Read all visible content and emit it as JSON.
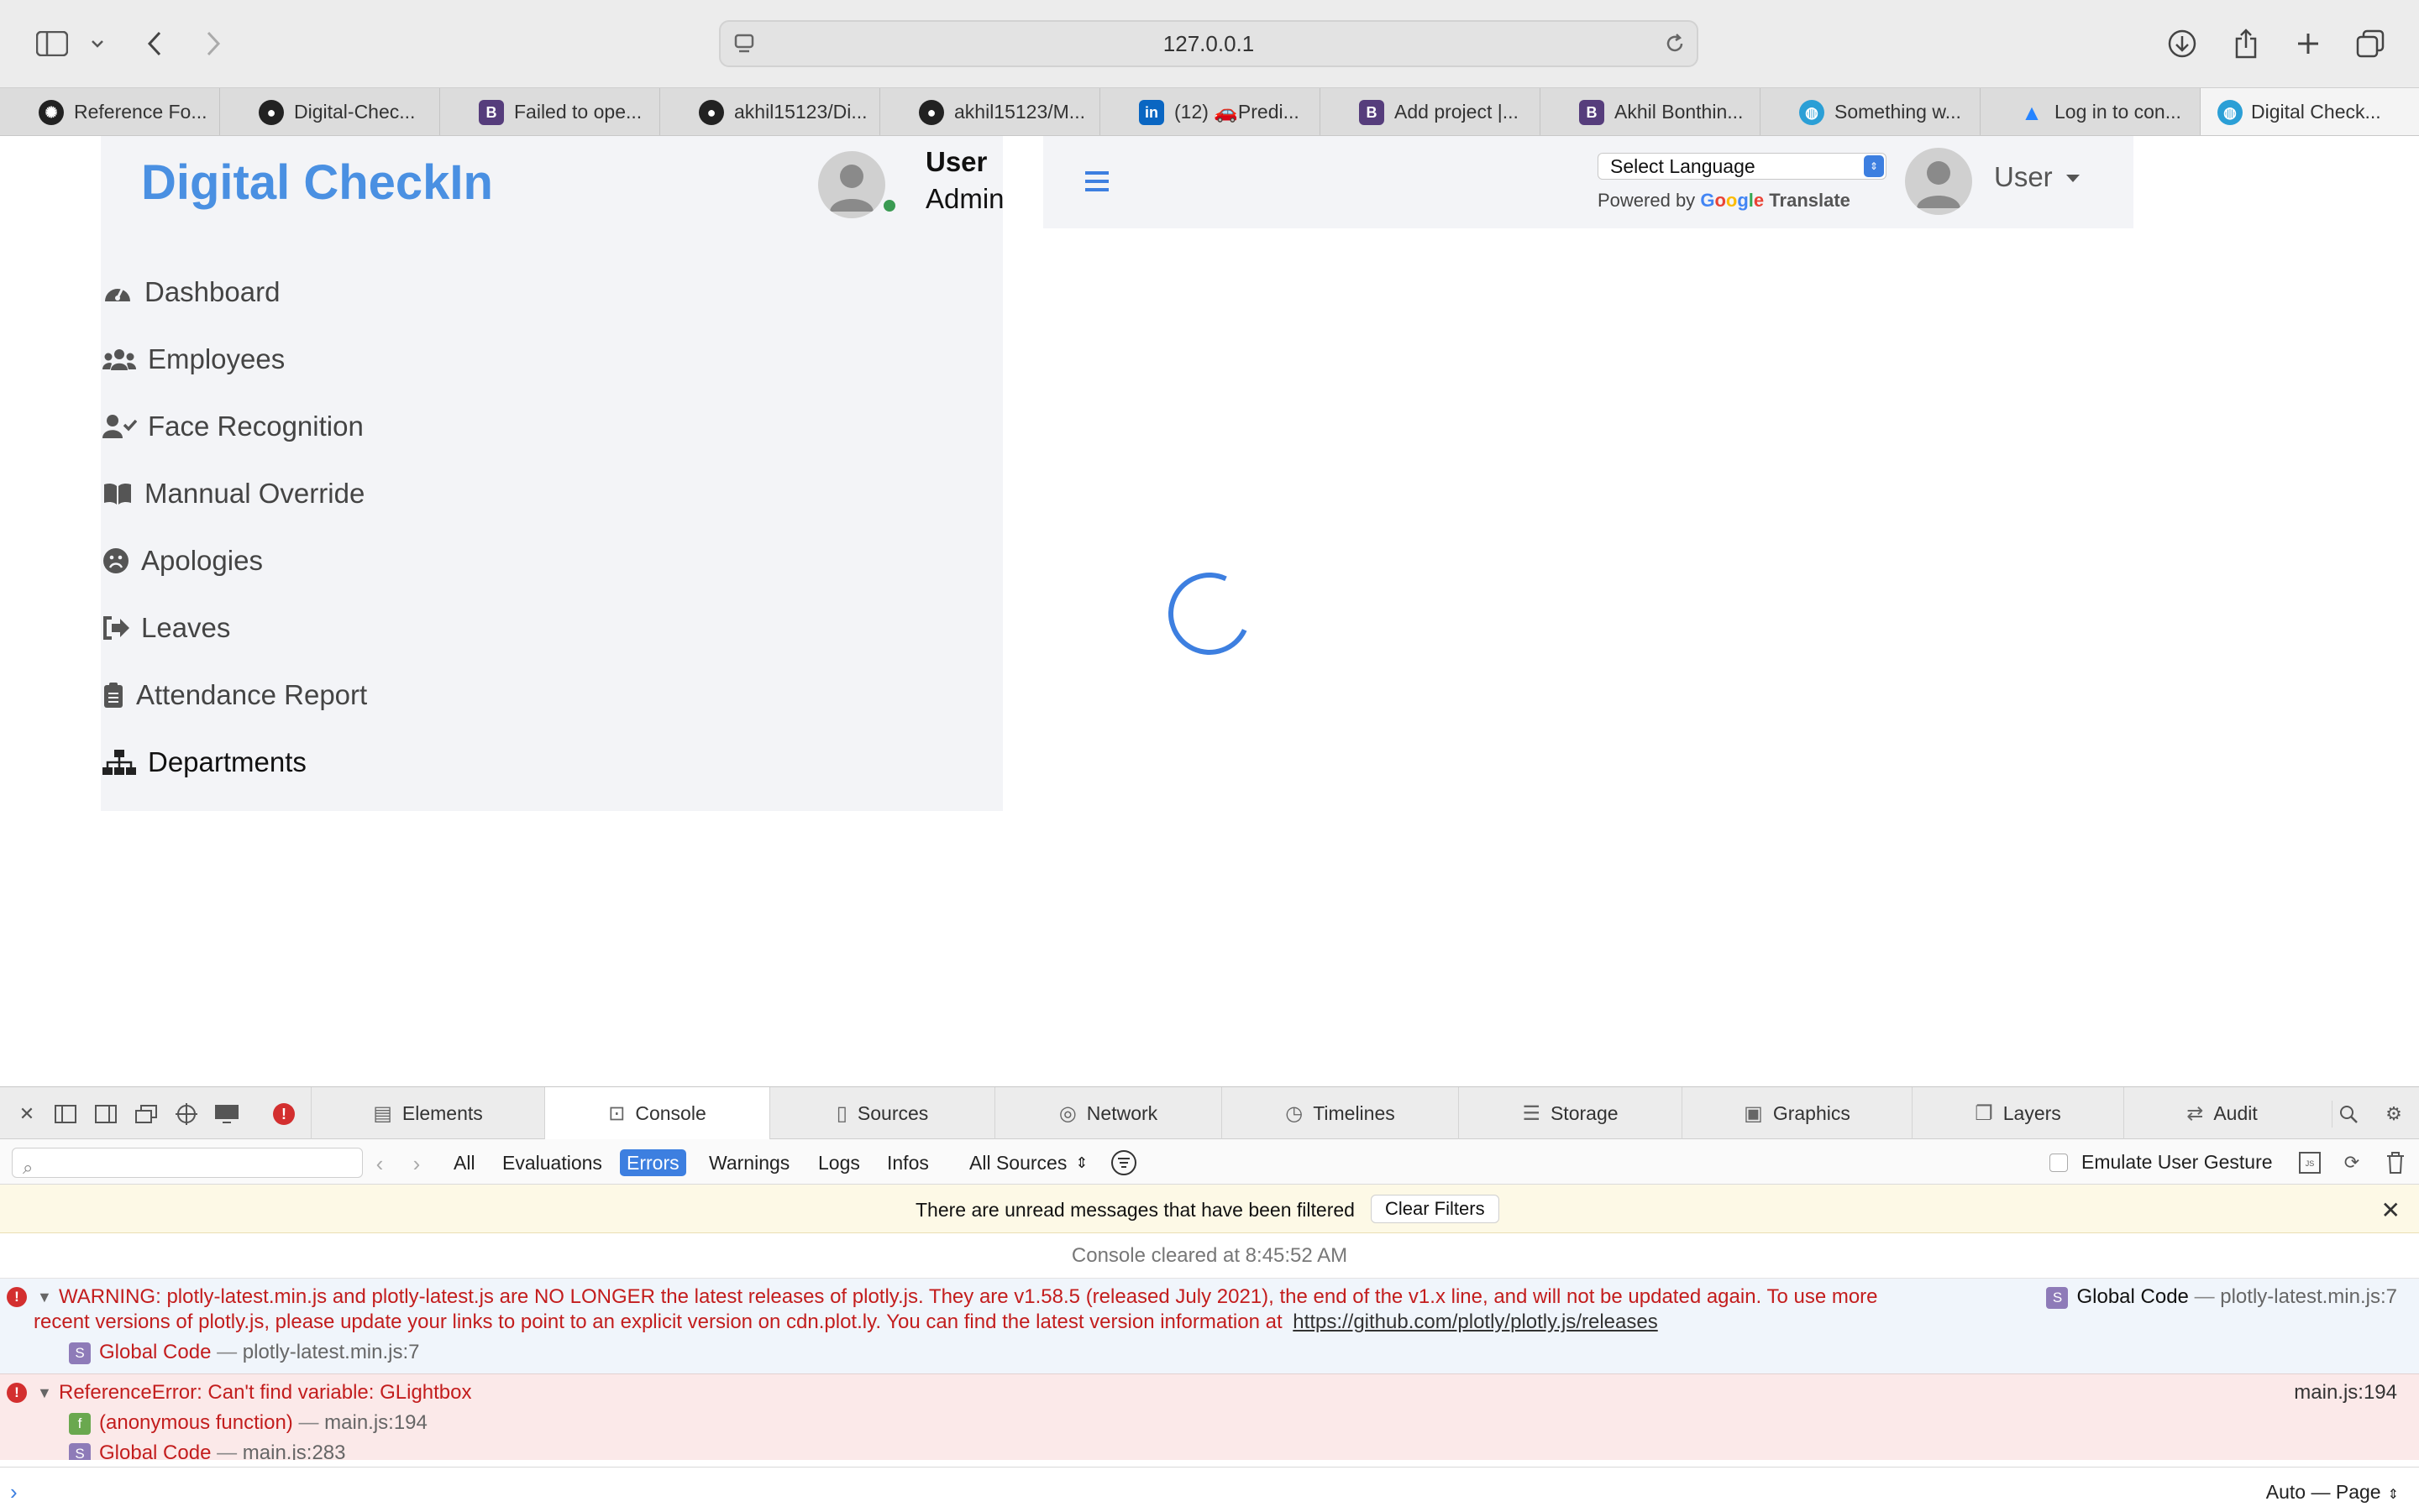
{
  "browser": {
    "url": "127.0.0.1",
    "tabs": [
      {
        "label": "Reference Fo...",
        "icon": "chatgpt-icon",
        "color": "#222222"
      },
      {
        "label": "Digital-Chec...",
        "icon": "github-icon",
        "color": "#222222"
      },
      {
        "label": "Failed to ope...",
        "icon": "bootstrap-icon",
        "color": "#563d7c"
      },
      {
        "label": "akhil15123/Di...",
        "icon": "github-icon",
        "color": "#222222"
      },
      {
        "label": "akhil15123/M...",
        "icon": "github-icon",
        "color": "#222222"
      },
      {
        "label": "(12) 🚗Predi...",
        "icon": "linkedin-icon",
        "color": "#0a66c2"
      },
      {
        "label": "Add project |...",
        "icon": "bootstrap-icon",
        "color": "#563d7c"
      },
      {
        "label": "Akhil Bonthin...",
        "icon": "bootstrap-icon",
        "color": "#563d7c"
      },
      {
        "label": "Something w...",
        "icon": "globe-icon",
        "color": "#2b9fd6"
      },
      {
        "label": "Log in to con...",
        "icon": "atlassian-icon",
        "color": "#2684ff"
      },
      {
        "label": "Digital Check...",
        "icon": "globe-icon",
        "color": "#2b9fd6"
      }
    ]
  },
  "app": {
    "brand": "Digital CheckIn",
    "profile": {
      "name": "User",
      "role": "Admin"
    },
    "nav": [
      {
        "label": "Dashboard",
        "icon": "tachometer-icon"
      },
      {
        "label": "Employees",
        "icon": "users-icon"
      },
      {
        "label": "Face Recognition",
        "icon": "user-check-icon"
      },
      {
        "label": "Mannual Override",
        "icon": "book-icon"
      },
      {
        "label": "Apologies",
        "icon": "frown-icon"
      },
      {
        "label": "Leaves",
        "icon": "sign-out-icon"
      },
      {
        "label": "Attendance Report",
        "icon": "clipboard-icon"
      },
      {
        "label": "Departments",
        "icon": "sitemap-icon"
      }
    ],
    "header": {
      "language_select": "Select Language",
      "powered_by": "Powered by",
      "google": "Google",
      "translate": "Translate",
      "user": "User"
    }
  },
  "inspector": {
    "tabs": [
      {
        "label": "Elements",
        "icon": "elements-icon"
      },
      {
        "label": "Console",
        "icon": "console-icon"
      },
      {
        "label": "Sources",
        "icon": "document-icon"
      },
      {
        "label": "Network",
        "icon": "network-icon"
      },
      {
        "label": "Timelines",
        "icon": "clock-icon"
      },
      {
        "label": "Storage",
        "icon": "database-icon"
      },
      {
        "label": "Graphics",
        "icon": "image-icon"
      },
      {
        "label": "Layers",
        "icon": "layers-icon"
      },
      {
        "label": "Audit",
        "icon": "audit-icon"
      }
    ],
    "filters": [
      "All",
      "Evaluations",
      "Errors",
      "Warnings",
      "Logs",
      "Infos"
    ],
    "active_filter": "Errors",
    "sources": "All Sources",
    "emulate": "Emulate User Gesture",
    "unread_text": "There are unread messages that have been filtered",
    "clear_filters": "Clear Filters",
    "cleared": "Console cleared at 8:45:52 AM",
    "messages": [
      {
        "line1": "WARNING: plotly-latest.min.js and plotly-latest.js are NO LONGER the latest releases of plotly.js. They are v1.58.5 (released July 2021), the end of the v1.x line, and will not be updated again. To use more",
        "line2": "recent versions of plotly.js, please update your links to point to an explicit version on cdn.plot.ly. You can find the latest version information at",
        "link": "https://github.com/plotly/plotly.js/releases",
        "frame_name": "Global Code",
        "frame_source": "plotly-latest.min.js:7",
        "right_name": "Global Code",
        "right_source": "plotly-latest.min.js:7"
      },
      {
        "line1": "ReferenceError: Can't find variable: GLightbox",
        "right_source": "main.js:194",
        "frames": [
          {
            "name": "(anonymous function)",
            "source": "main.js:194",
            "badge": "f"
          },
          {
            "name": "Global Code",
            "source": "main.js:283",
            "badge": "S"
          }
        ]
      }
    ],
    "dash": "—",
    "mode": "Auto — Page"
  }
}
